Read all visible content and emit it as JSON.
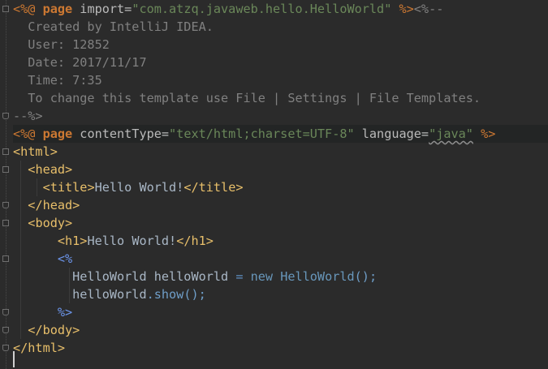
{
  "editor": {
    "lines": [
      {
        "parts": [
          {
            "text": "<%@ ",
            "cls": "dir"
          },
          {
            "text": "page",
            "cls": "dirname"
          },
          {
            "text": " import=",
            "cls": "attr"
          },
          {
            "text": "\"com.atzq.javaweb.hello.HelloWorld\"",
            "cls": "str"
          },
          {
            "text": " %>",
            "cls": "dir"
          },
          {
            "text": "<%--",
            "cls": "cm"
          }
        ]
      },
      {
        "parts": [
          {
            "text": "  Created by IntelliJ IDEA.",
            "cls": "cm"
          }
        ]
      },
      {
        "parts": [
          {
            "text": "  User: 12852",
            "cls": "cm"
          }
        ]
      },
      {
        "parts": [
          {
            "text": "  Date: 2017/11/17",
            "cls": "cm"
          }
        ]
      },
      {
        "parts": [
          {
            "text": "  Time: 7:35",
            "cls": "cm"
          }
        ]
      },
      {
        "parts": [
          {
            "text": "  To change this template use File | Settings | File Templates.",
            "cls": "cm"
          }
        ]
      },
      {
        "parts": [
          {
            "text": "--%>",
            "cls": "cm"
          }
        ]
      },
      {
        "parts": [
          {
            "text": "<%@ ",
            "cls": "dir"
          },
          {
            "text": "page",
            "cls": "dirname"
          },
          {
            "text": " contentType=",
            "cls": "attr"
          },
          {
            "text": "\"text/html;charset=UTF-8\"",
            "cls": "str"
          },
          {
            "text": " language=",
            "cls": "attr"
          },
          {
            "text": "\"java\"",
            "cls": "str squiggle"
          },
          {
            "text": " %>",
            "cls": "dir"
          }
        ],
        "highlight": true
      },
      {
        "parts": [
          {
            "text": "<html>",
            "cls": "t"
          }
        ]
      },
      {
        "parts": [
          {
            "text": "  ",
            "cls": "plain"
          },
          {
            "text": "<head>",
            "cls": "t"
          }
        ]
      },
      {
        "parts": [
          {
            "text": "    ",
            "cls": "plain"
          },
          {
            "text": "<title>",
            "cls": "t"
          },
          {
            "text": "Hello World!",
            "cls": "plain"
          },
          {
            "text": "</title>",
            "cls": "t"
          }
        ]
      },
      {
        "parts": [
          {
            "text": "  ",
            "cls": "plain"
          },
          {
            "text": "</head>",
            "cls": "t"
          }
        ]
      },
      {
        "parts": [
          {
            "text": "  ",
            "cls": "plain"
          },
          {
            "text": "<body>",
            "cls": "t"
          }
        ]
      },
      {
        "parts": [
          {
            "text": "      ",
            "cls": "plain"
          },
          {
            "text": "<h1>",
            "cls": "t"
          },
          {
            "text": "Hello World!",
            "cls": "plain"
          },
          {
            "text": "</h1>",
            "cls": "t"
          }
        ]
      },
      {
        "parts": [
          {
            "text": "      ",
            "cls": "plain"
          },
          {
            "text": "<%",
            "cls": "jspdelim"
          }
        ]
      },
      {
        "parts": [
          {
            "text": "        HelloWorld helloWorld ",
            "cls": "plain"
          },
          {
            "text": "=",
            "cls": "op"
          },
          {
            "text": " ",
            "cls": "plain"
          },
          {
            "text": "new",
            "cls": "new"
          },
          {
            "text": " ",
            "cls": "plain"
          },
          {
            "text": "HelloWorld",
            "cls": "cls"
          },
          {
            "text": "();",
            "cls": "meth"
          }
        ]
      },
      {
        "parts": [
          {
            "text": "        helloWorld",
            "cls": "plain"
          },
          {
            "text": ".show",
            "cls": "meth"
          },
          {
            "text": "();",
            "cls": "meth"
          }
        ]
      },
      {
        "parts": [
          {
            "text": "      ",
            "cls": "plain"
          },
          {
            "text": "%>",
            "cls": "jspdelim"
          }
        ]
      },
      {
        "parts": [
          {
            "text": "  ",
            "cls": "plain"
          },
          {
            "text": "</body>",
            "cls": "t"
          }
        ]
      },
      {
        "parts": [
          {
            "text": "</html>",
            "cls": "t"
          }
        ]
      },
      {
        "parts": [
          {
            "text": "",
            "cls": "plain"
          }
        ]
      }
    ]
  },
  "colors": {
    "background": "#2b2b2b",
    "tag": "#e8bf6a",
    "keyword": "#cc7832",
    "string": "#6a8759",
    "comment": "#808080",
    "text": "#a9b7c6"
  },
  "icons": {
    "fold_marker": "fold-marker-icon"
  }
}
